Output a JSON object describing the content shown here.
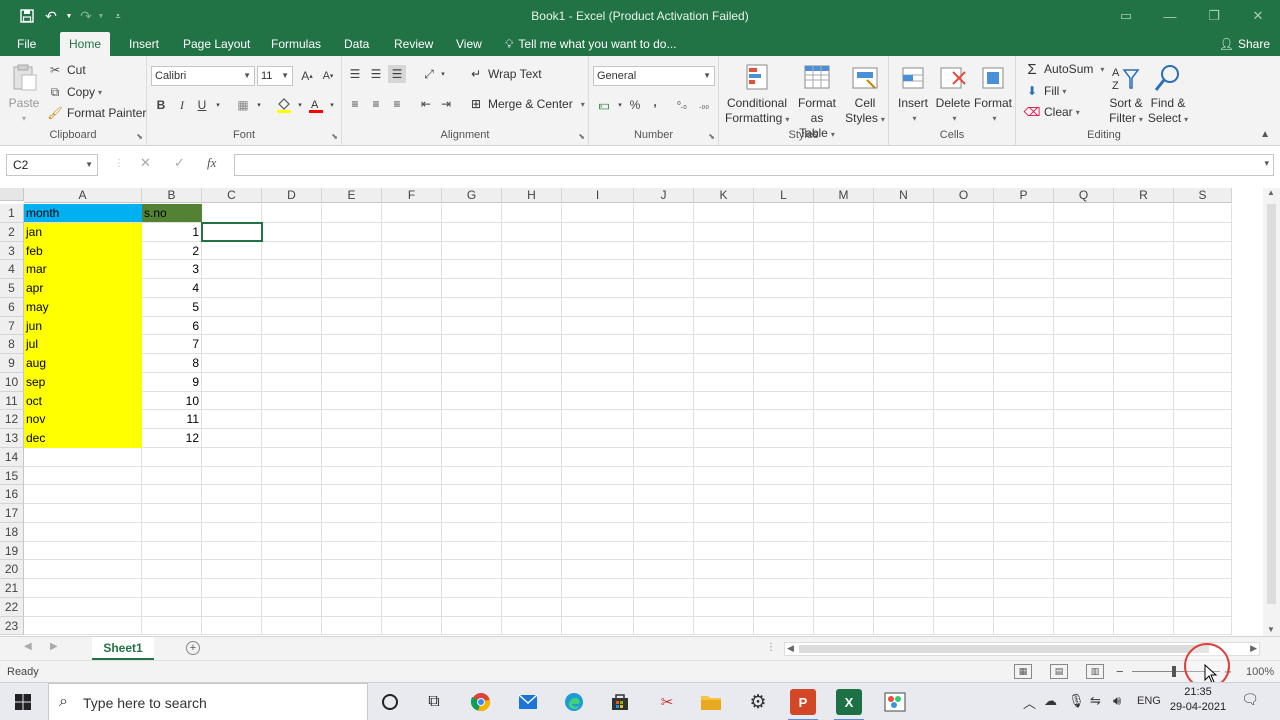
{
  "window": {
    "title": "Book1 - Excel (Product Activation Failed)",
    "share_label": "Share"
  },
  "tabs": {
    "file": "File",
    "items": [
      "Home",
      "Insert",
      "Page Layout",
      "Formulas",
      "Data",
      "Review",
      "View"
    ],
    "active": "Home",
    "tell_me": "Tell me what you want to do..."
  },
  "ribbon": {
    "clipboard": {
      "paste": "Paste",
      "cut": "Cut",
      "copy": "Copy",
      "format_painter": "Format Painter",
      "label": "Clipboard"
    },
    "font": {
      "name": "Calibri",
      "size": "11",
      "bold": "B",
      "italic": "I",
      "underline": "U",
      "label": "Font"
    },
    "alignment": {
      "wrap_text": "Wrap Text",
      "merge_center": "Merge & Center",
      "label": "Alignment"
    },
    "number": {
      "format": "General",
      "percent": "%",
      "comma": ",",
      "label": "Number"
    },
    "styles": {
      "conditional": [
        "Conditional",
        "Formatting"
      ],
      "format_table": [
        "Format as",
        "Table"
      ],
      "cell_styles": [
        "Cell",
        "Styles"
      ],
      "label": "Styles"
    },
    "cells": {
      "insert": "Insert",
      "delete": "Delete",
      "format": "Format",
      "label": "Cells"
    },
    "editing": {
      "autosum": "AutoSum",
      "fill": "Fill",
      "clear": "Clear",
      "sort_filter": [
        "Sort &",
        "Filter"
      ],
      "find_select": [
        "Find &",
        "Select"
      ],
      "label": "Editing"
    }
  },
  "formula_bar": {
    "name_box": "C2",
    "fx": "fx",
    "cancel": "✕",
    "enter": "✓",
    "value": ""
  },
  "sheet": {
    "columns": [
      "A",
      "B",
      "C",
      "D",
      "E",
      "F",
      "G",
      "H",
      "I",
      "J",
      "K",
      "L",
      "M",
      "N",
      "O",
      "P",
      "Q",
      "R",
      "S"
    ],
    "rows": [
      "1",
      "2",
      "3",
      "4",
      "5",
      "6",
      "7",
      "8",
      "9",
      "10",
      "11",
      "12",
      "13",
      "14",
      "15",
      "16",
      "17",
      "18",
      "19",
      "20",
      "21",
      "22",
      "23"
    ],
    "header": [
      "month",
      "s.no"
    ],
    "data": [
      [
        "jan",
        "1"
      ],
      [
        "feb",
        "2"
      ],
      [
        "mar",
        "3"
      ],
      [
        "apr",
        "4"
      ],
      [
        "may",
        "5"
      ],
      [
        "jun",
        "6"
      ],
      [
        "jul",
        "7"
      ],
      [
        "aug",
        "8"
      ],
      [
        "sep",
        "9"
      ],
      [
        "oct",
        "10"
      ],
      [
        "nov",
        "11"
      ],
      [
        "dec",
        "12"
      ]
    ],
    "colors": {
      "header_a": "#00b0f0",
      "header_b": "#548235",
      "fill_a": "#ffff00",
      "selection": "#217346"
    },
    "selected_cell": "C2"
  },
  "sheet_tabs": {
    "active": "Sheet1",
    "add_label": "+"
  },
  "status": {
    "ready": "Ready",
    "zoom": "100%",
    "zoom_out": "−",
    "zoom_in": "+"
  },
  "taskbar": {
    "search_placeholder": "Type here to search",
    "apps": [
      "cortana-icon",
      "task-view-icon",
      "chrome-icon",
      "mail-icon",
      "edge-icon",
      "store-icon",
      "snipping-icon",
      "explorer-icon",
      "settings-icon",
      "powerpoint-icon",
      "excel-icon",
      "paint-icon"
    ],
    "lang": "ENG",
    "time": "21:35",
    "date": "29-04-2021"
  }
}
